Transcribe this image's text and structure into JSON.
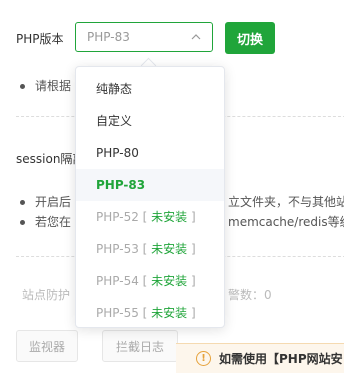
{
  "php_label": "PHP版本",
  "select": {
    "value": "PHP-83"
  },
  "switch_button": "切换",
  "note_1": "请根据",
  "section_title": "session隔离",
  "bullets": [
    {
      "left": "开启后",
      "right": "立文件夹，不与其他站"
    },
    {
      "left": "若您在",
      "right": "memcache/redis等缓"
    }
  ],
  "protection_row": {
    "left": "站点防护",
    "right": "警数：0"
  },
  "buttons": {
    "monitor": "监视器",
    "blocklog": "拦截日志"
  },
  "notice": {
    "text": "如需使用【PHP网站安"
  },
  "dropdown": {
    "options": [
      {
        "label": "纯静态",
        "suffix": "",
        "state": "normal"
      },
      {
        "label": "自定义",
        "suffix": "",
        "state": "normal"
      },
      {
        "label": "PHP-80",
        "suffix": "",
        "state": "normal"
      },
      {
        "label": "PHP-83",
        "suffix": "",
        "state": "selected"
      },
      {
        "label": "PHP-52",
        "suffix": "未安装",
        "state": "disabled"
      },
      {
        "label": "PHP-53",
        "suffix": "未安装",
        "state": "disabled"
      },
      {
        "label": "PHP-54",
        "suffix": "未安装",
        "state": "disabled"
      },
      {
        "label": "PHP-55",
        "suffix": "未安装",
        "state": "disabled"
      }
    ]
  },
  "colors": {
    "accent": "#20a53a",
    "warning": "#e6a23c"
  }
}
